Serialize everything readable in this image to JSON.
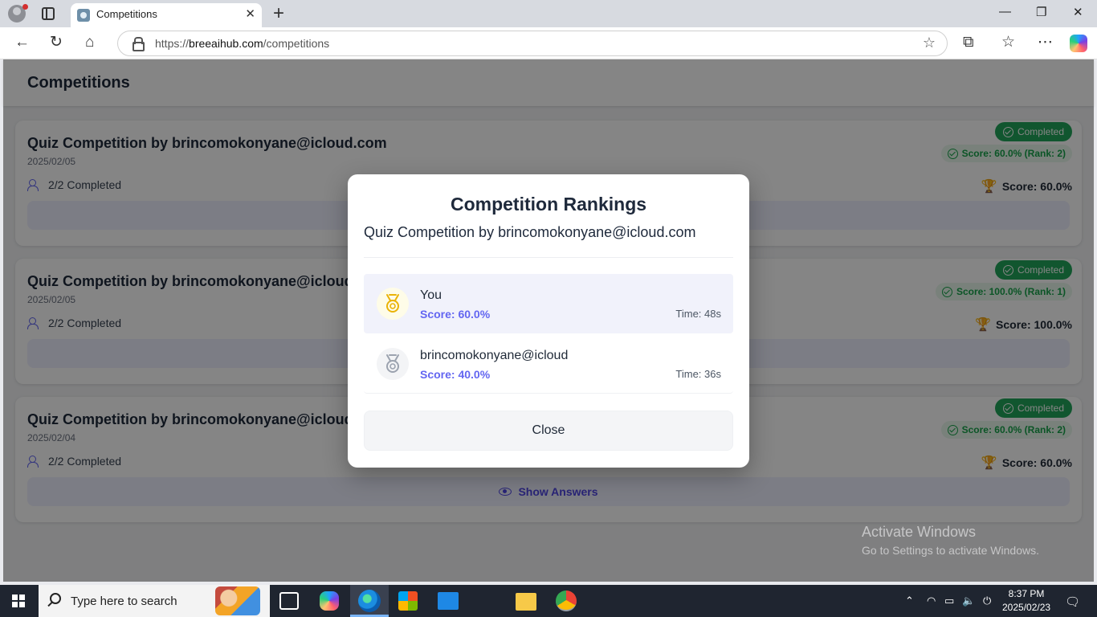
{
  "browser": {
    "tab_title": "Competitions",
    "url_prefix": "https://",
    "url_domain": "breeaihub.com",
    "url_path": "/competitions"
  },
  "page": {
    "title": "Competitions",
    "cards": [
      {
        "title": "Quiz Competition by brincomokonyane@icloud.com",
        "date": "2025/02/05",
        "participants": "2/2 Completed",
        "badge": "Completed",
        "rank_text": "Score: 60.0% (Rank: 2)",
        "score": "Score: 60.0%"
      },
      {
        "title": "Quiz Competition by brincomokonyane@icloud.com",
        "date": "2025/02/05",
        "participants": "2/2 Completed",
        "badge": "Completed",
        "rank_text": "Score: 100.0% (Rank: 1)",
        "score": "Score: 100.0%"
      },
      {
        "title": "Quiz Competition by brincomokonyane@icloud.com",
        "date": "2025/02/04",
        "participants": "2/2 Completed",
        "badge": "Completed",
        "rank_text": "Score: 60.0% (Rank: 2)",
        "score": "Score: 60.0%",
        "action": "Show Answers"
      }
    ]
  },
  "modal": {
    "title": "Competition Rankings",
    "subtitle": "Quiz Competition by brincomokonyane@icloud.com",
    "rankings": [
      {
        "name": "You",
        "score": "Score: 60.0%",
        "time": "Time: 48s",
        "medal": "gold-medal-icon"
      },
      {
        "name": "brincomokonyane@icloud",
        "score": "Score: 40.0%",
        "time": "Time: 36s",
        "medal": "silver-medal-icon"
      }
    ],
    "close_label": "Close"
  },
  "watermark": {
    "line1": "Activate Windows",
    "line2": "Go to Settings to activate Windows."
  },
  "taskbar": {
    "search_placeholder": "Type here to search",
    "time": "8:37 PM",
    "date": "2025/02/23"
  },
  "colors": {
    "accent": "#6366f1",
    "success": "#22a55a",
    "gold": "#eab308",
    "silver": "#9ca3af"
  }
}
